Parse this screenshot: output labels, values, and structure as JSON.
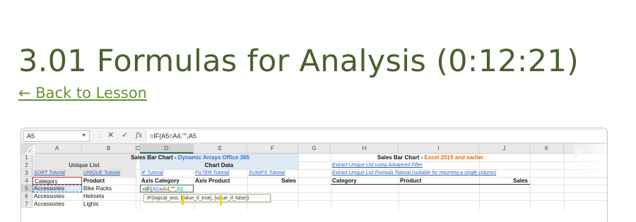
{
  "page": {
    "title": "3.01 Formulas for Analysis (0:12:21)",
    "back_link": "← Back to Lesson"
  },
  "colors": {
    "title": "#4a5f2e",
    "link": "#6a8f2e",
    "excel_green": "#217346"
  },
  "excel": {
    "namebox": "A5",
    "toolbar_icons": [
      "cancel-icon",
      "enter-icon",
      "function-icon"
    ],
    "cancel_glyph": "✕",
    "enter_glyph": "✓",
    "fx_glyph": "fx",
    "formula": "=IF(A5=A4,\"\",A5",
    "columns": [
      "A",
      "B",
      "C",
      "D",
      "E",
      "F",
      "G",
      "H",
      "I",
      "J",
      "K"
    ],
    "rows": [
      "1",
      "2",
      "3",
      "4",
      "5",
      "6",
      "7"
    ],
    "row1": {
      "title_left_a": "Sales Bar Chart - ",
      "title_left_b": "Dynamic Arrays Office 365",
      "title_right_a": "Sales Bar Chart - ",
      "title_right_b": "Excel 2019 and earlier"
    },
    "row2": {
      "unique_list": "Unique List",
      "chart_data": "Chart Data",
      "extract_advanced": "Extract Unique List using Advanced Filter"
    },
    "row3": {
      "sort_tutorial": "SORT Tutorial",
      "unique_tutorial": "UNIQUE Tutorial",
      "if_tutorial": "IF Tutorial",
      "filter_tutorial": "FILTER Tutorial",
      "sumifs_tutorial": "SUMIFS Tutorial",
      "extract_formula": "Extract Unique List Formula Tutorial (suitable for returning a single column)"
    },
    "row4": {
      "category": "Category",
      "product": "Product",
      "axis_category": "Axis Category",
      "axis_product": "Axis Product",
      "sales": "Sales",
      "category_h": "Category",
      "product_i": "Product",
      "sales_j": "Sales"
    },
    "row5": {
      "a": "Accessories",
      "b": "Bike Racks",
      "d_prefix": "=IF(",
      "d_a5": "A5",
      "d_eq": "=",
      "d_a4": "A4",
      "d_quotes": ",\"\",",
      "d_a5b": "A5"
    },
    "row6": {
      "a": "Accessories",
      "b": "Helmets",
      "tooltip": "IF(logical_test, [value_if_true], [value_if_false])"
    },
    "row7": {
      "a": "Accessories",
      "b": "Lights"
    }
  }
}
